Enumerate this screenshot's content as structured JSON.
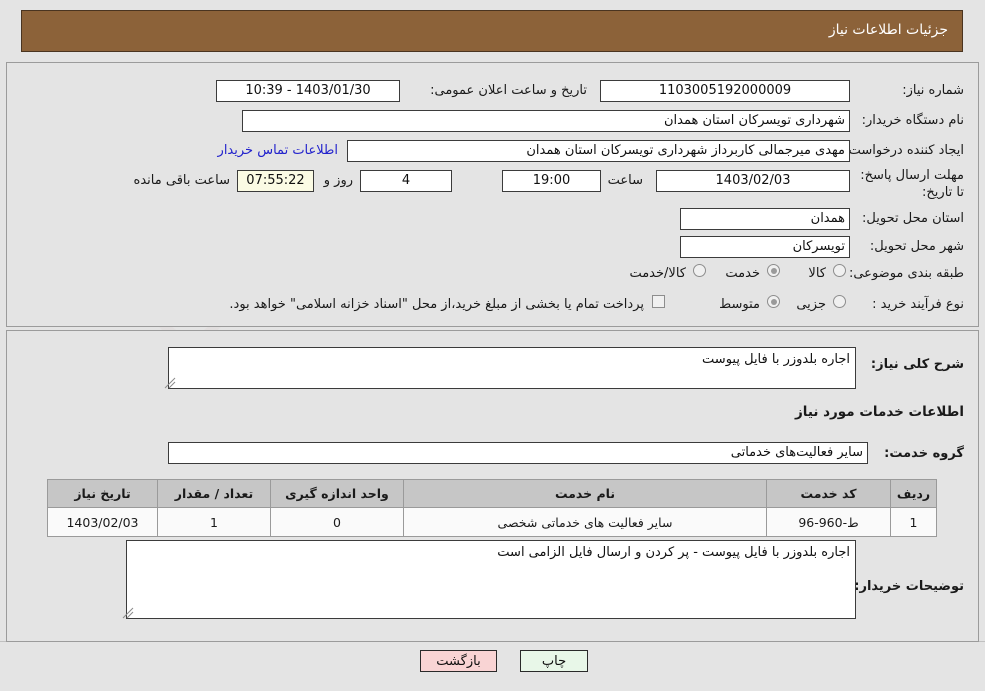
{
  "header": {
    "title": "جزئیات اطلاعات نیاز"
  },
  "top_form": {
    "need_number": {
      "label": "شماره نیاز:",
      "value": "1103005192000009"
    },
    "public_announce": {
      "label": "تاریخ و ساعت اعلان عمومی:",
      "value": "1403/01/30 - 10:39"
    },
    "buyer_org": {
      "label": "نام دستگاه خریدار:",
      "value": "شهرداری تویسرکان استان همدان"
    },
    "requester": {
      "label": "ایجاد کننده درخواست:",
      "value": "مهدی میرجمالی کاربرداز شهرداری تویسرکان استان همدان"
    },
    "contact_link": "اطلاعات تماس خریدار",
    "deadline": {
      "label": "مهلت ارسال پاسخ: تا تاریخ:",
      "date": "1403/02/03",
      "hour_label": "ساعت",
      "hour": "19:00",
      "days": "4",
      "days_label": "روز و",
      "timer": "07:55:22",
      "timer_label": "ساعت باقی مانده"
    },
    "province": {
      "label": "استان محل تحویل:",
      "value": "همدان"
    },
    "city": {
      "label": "شهر محل تحویل:",
      "value": "تویسرکان"
    },
    "category": {
      "label": "طبقه بندی موضوعی:",
      "options": [
        "کالا",
        "خدمت",
        "کالا/خدمت"
      ],
      "selected": "خدمت"
    },
    "process_type": {
      "label": "نوع فرآیند خرید :",
      "options": [
        "جزیی",
        "متوسط"
      ],
      "selected": "متوسط",
      "treasury_note": "پرداخت تمام یا بخشی از مبلغ خرید،از محل \"اسناد خزانه اسلامی\" خواهد بود."
    }
  },
  "mid_form": {
    "need_description": {
      "label": "شرح کلی نیاز:",
      "value": "اجاره بلدوزر با فایل پیوست"
    },
    "services_heading": "اطلاعات خدمات مورد نیاز",
    "service_group": {
      "label": "گروه خدمت:",
      "value": "سایر فعالیت‌های خدماتی"
    },
    "table": {
      "columns": [
        "ردیف",
        "کد خدمت",
        "نام خدمت",
        "واحد اندازه گیری",
        "تعداد / مقدار",
        "تاریخ نیاز"
      ],
      "rows": [
        [
          "1",
          "ط-960-96",
          "سایر فعالیت های خدماتی شخصی",
          "0",
          "1",
          "1403/02/03"
        ]
      ]
    },
    "buyer_notes": {
      "label": "توضیحات خریدار:",
      "value": "اجاره بلدوزر با فایل پیوست - پر کردن و ارسال فایل الزامی است"
    }
  },
  "footer": {
    "print_label": "چاپ",
    "back_label": "بازگشت"
  },
  "colors": {
    "header_bg": "#8c6239",
    "panel_bg": "#e4e4e4",
    "link": "#2222cc",
    "timer_bg": "#fbfbe4",
    "print_bg": "#e8f7e8",
    "back_bg": "#f9d4d4"
  }
}
